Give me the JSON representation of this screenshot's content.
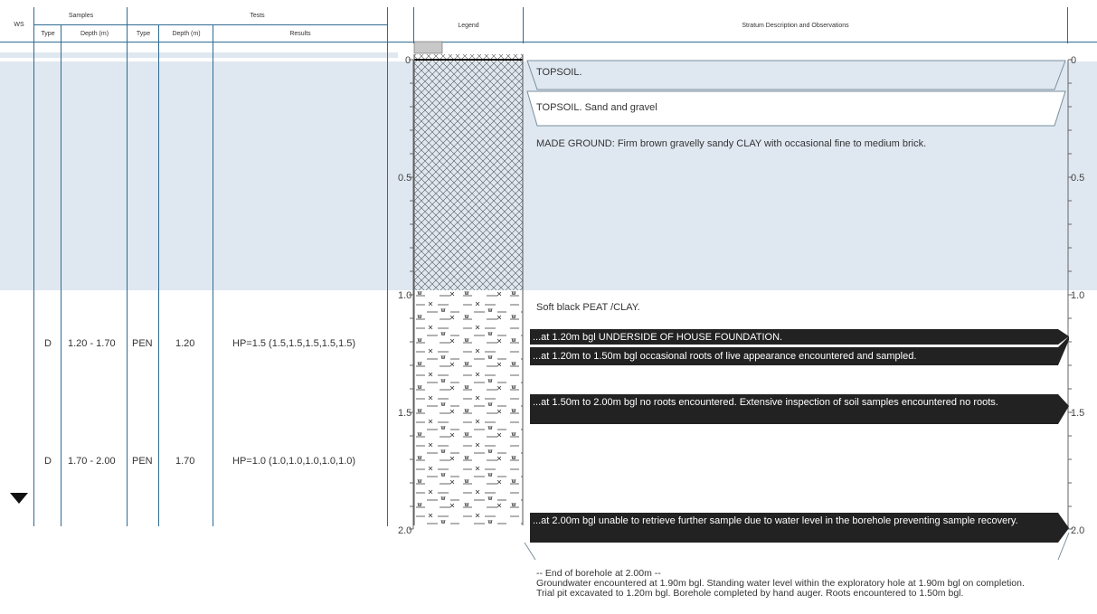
{
  "header": {
    "ws": "WS",
    "samples": "Samples",
    "tests": "Tests",
    "legend": "Legend",
    "stratum": "Stratum Description and Observations",
    "sub": {
      "type": "Type",
      "depth": "Depth (m)",
      "test_type": "Type",
      "test_depth": "Depth (m)",
      "results": "Results"
    }
  },
  "depth_labels": [
    "0",
    "0.5",
    "1.0",
    "1.5",
    "2.0"
  ],
  "samples": [
    {
      "type": "D",
      "depth": "1.20 - 1.70",
      "test_type": "PEN",
      "test_depth": "1.20",
      "result": "HP=1.5 (1.5,1.5,1.5,1.5,1.5)"
    },
    {
      "type": "D",
      "depth": "1.70 - 2.00",
      "test_type": "PEN",
      "test_depth": "1.70",
      "result": "HP=1.0 (1.0,1.0,1.0,1.0,1.0)"
    }
  ],
  "strata": {
    "topsoil": "TOPSOIL.",
    "topsoil_sand": "TOPSOIL. Sand and gravel",
    "made_ground": "MADE GROUND: Firm brown gravelly sandy CLAY with occasional fine to medium brick.",
    "peat": "Soft black PEAT /CLAY."
  },
  "observations": [
    "...at 1.20m bgl UNDERSIDE OF HOUSE FOUNDATION.",
    "...at 1.20m to 1.50m bgl occasional roots of live appearance encountered and sampled.",
    "...at 1.50m to 2.00m bgl no roots encountered.  Extensive inspection of soil samples encountered no roots.",
    "...at 2.00m bgl unable to retrieve further sample due to water level in the borehole preventing sample recovery."
  ],
  "end_notes": {
    "line1": "-- End of borehole at 2.00m --",
    "line2": "Groundwater encountered at 1.90m bgl.  Standing water level within the exploratory hole at 1.90m bgl on completion. Trial pit excavated to 1.20m bgl. Borehole completed by hand auger. Roots encountered to 1.50m bgl."
  },
  "colors": {
    "band": "#dfe8f1",
    "rule": "#2f6b93",
    "dark_box": "#222222"
  },
  "icons": {
    "water_strike": "down-triangle-icon"
  }
}
